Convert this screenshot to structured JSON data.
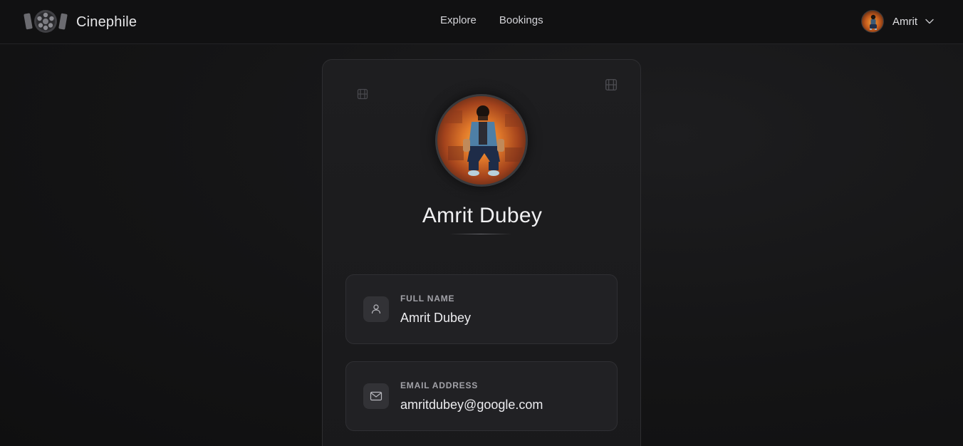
{
  "header": {
    "brand_name": "Cinephile",
    "brand_icon": "film-reel-logo",
    "nav": [
      {
        "label": "Explore"
      },
      {
        "label": "Bookings"
      }
    ],
    "user": {
      "name": "Amrit",
      "avatar_icon": "user-avatar",
      "menu_icon": "chevron-down-icon"
    }
  },
  "profile": {
    "display_name": "Amrit Dubey",
    "fields": [
      {
        "label": "FULL NAME",
        "value": "Amrit Dubey",
        "icon": "user-icon"
      },
      {
        "label": "EMAIL ADDRESS",
        "value": "amritdubey@google.com",
        "icon": "mail-icon"
      }
    ]
  },
  "colors": {
    "background": "#141415",
    "card": "#1e1e20",
    "accent": "#e0782a"
  }
}
